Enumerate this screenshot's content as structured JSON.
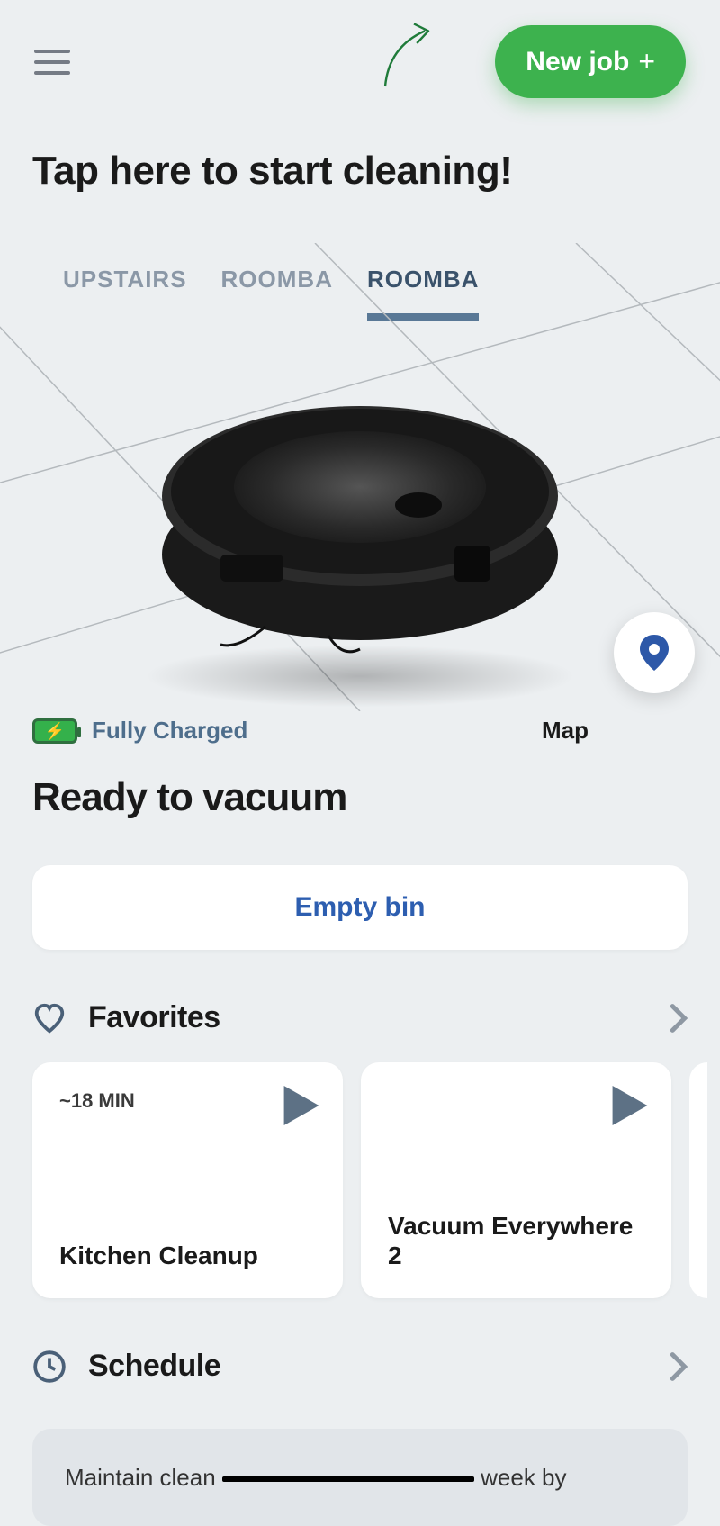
{
  "header": {
    "new_job_label": "New job"
  },
  "tap_title": "Tap here to start cleaning!",
  "tabs": [
    {
      "label": "UPSTAIRS",
      "active": false
    },
    {
      "label": "ROOMBA",
      "active": false
    },
    {
      "label": "ROOMBA",
      "active": true
    }
  ],
  "battery": {
    "status_text": "Fully Charged",
    "icon": "battery-charging-full"
  },
  "map_label": "Map",
  "device_status": "Ready to vacuum",
  "empty_bin_label": "Empty bin",
  "favorites": {
    "title": "Favorites",
    "items": [
      {
        "duration": "~18 MIN",
        "title": "Kitchen Cleanup"
      },
      {
        "duration": "",
        "title": "Vacuum Everywhere 2"
      }
    ]
  },
  "schedule": {
    "title": "Schedule",
    "promo_pre": "Maintain clean",
    "promo_post": "week by"
  },
  "colors": {
    "accent_green": "#3db24e",
    "link_blue": "#2d5eb0",
    "tab_active": "#3a526b",
    "tab_underline": "#597896"
  }
}
